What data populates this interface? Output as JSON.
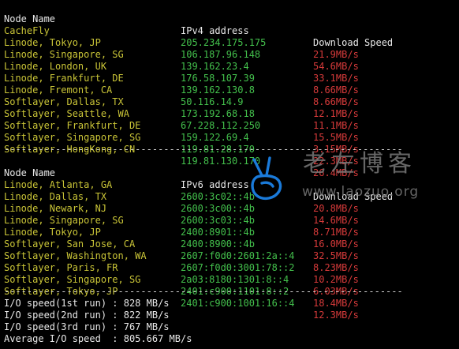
{
  "ipv4": {
    "headers": [
      "Node Name",
      "IPv4 address",
      "Download Speed"
    ],
    "rows": [
      [
        "CacheFly",
        "205.234.175.175",
        "21.9MB/s"
      ],
      [
        "Linode, Tokyo, JP",
        "106.187.96.148",
        "54.6MB/s"
      ],
      [
        "Linode, Singapore, SG",
        "139.162.23.4",
        "33.1MB/s"
      ],
      [
        "Linode, London, UK",
        "176.58.107.39",
        "8.66MB/s"
      ],
      [
        "Linode, Frankfurt, DE",
        "139.162.130.8",
        "8.66MB/s"
      ],
      [
        "Linode, Fremont, CA",
        "50.116.14.9",
        "12.1MB/s"
      ],
      [
        "Softlayer, Dallas, TX",
        "173.192.68.18",
        "11.1MB/s"
      ],
      [
        "Softlayer, Seattle, WA",
        "67.228.112.250",
        "15.5MB/s"
      ],
      [
        "Softlayer, Frankfurt, DE",
        "159.122.69.4",
        "3.15MB/s"
      ],
      [
        "Softlayer, Singapore, SG",
        "119.81.28.170",
        "22.3MB/s"
      ],
      [
        "Softlayer, HongKong, CN",
        "119.81.130.170",
        "26.4MB/s"
      ]
    ]
  },
  "separator": "----------------------------------------------------------------------",
  "ipv6": {
    "headers": [
      "Node Name",
      "IPv6 address",
      "Download Speed"
    ],
    "rows": [
      [
        "Linode, Atlanta, GA",
        "2600:3c02::4b",
        "20.8MB/s"
      ],
      [
        "Linode, Dallas, TX",
        "2600:3c00::4b",
        "14.6MB/s"
      ],
      [
        "Linode, Newark, NJ",
        "2600:3c03::4b",
        "8.71MB/s"
      ],
      [
        "Linode, Singapore, SG",
        "2400:8901::4b",
        "16.0MB/s"
      ],
      [
        "Linode, Tokyo, JP",
        "2400:8900::4b",
        "32.5MB/s"
      ],
      [
        "Softlayer, San Jose, CA",
        "2607:f0d0:2601:2a::4",
        "8.23MB/s"
      ],
      [
        "Softlayer, Washington, WA",
        "2607:f0d0:3001:78::2",
        "10.2MB/s"
      ],
      [
        "Softlayer, Paris, FR",
        "2a03:8180:1301:8::4",
        "6.03MB/s"
      ],
      [
        "Softlayer, Singapore, SG",
        "2401:c900:1101:8::2",
        "18.4MB/s"
      ],
      [
        "Softlayer, Tokyo, JP",
        "2401:c900:1001:16::4",
        "12.3MB/s"
      ]
    ]
  },
  "io": [
    "I/O speed(1st run) : 828 MB/s",
    "I/O speed(2nd run) : 822 MB/s",
    "I/O speed(3rd run) : 767 MB/s",
    "Average I/O speed  : 805.667 MB/s"
  ],
  "watermark": {
    "name": "老左博客",
    "url": "www.laozuo.org"
  },
  "colors": {
    "background": "#000000",
    "node": "#c9c437",
    "ip": "#43c04c",
    "speed": "#d63a3a",
    "header": "#e8e8e8",
    "watermark_logo": "#1a7ad9"
  }
}
